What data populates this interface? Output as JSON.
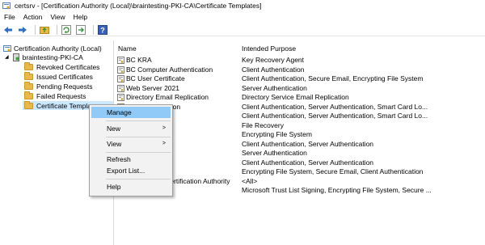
{
  "window": {
    "title": "certsrv - [Certification Authority (Local)\\braintesting-PKI-CA\\Certificate Templates]"
  },
  "menu": {
    "items": [
      "File",
      "Action",
      "View",
      "Help"
    ]
  },
  "toolbar": {
    "icons": [
      "back-icon",
      "forward-icon",
      "up-folder-icon",
      "refresh-icon",
      "export-icon",
      "help-icon"
    ]
  },
  "tree": {
    "root": "Certification Authority (Local)",
    "ca": "braintesting-PKI-CA",
    "items": [
      "Revoked Certificates",
      "Issued Certificates",
      "Pending Requests",
      "Failed Requests",
      "Certificate Templa"
    ]
  },
  "list": {
    "columns": {
      "name": "Name",
      "purpose": "Intended Purpose"
    },
    "rows": [
      {
        "name": "BC KRA",
        "purpose": "Key Recovery Agent"
      },
      {
        "name": "BC Computer Authentication",
        "purpose": "Client Authentication"
      },
      {
        "name": "BC User Certificate",
        "purpose": "Client Authentication, Secure Email, Encrypting File System"
      },
      {
        "name": "Web Server 2021",
        "purpose": "Server Authentication"
      },
      {
        "name": "Directory Email Replication",
        "purpose": "Directory Service Email Replication"
      },
      {
        "name": "ller Authentication",
        "purpose": "Client Authentication, Server Authentication, Smart Card Lo..."
      },
      {
        "name": "ntication",
        "purpose": "Client Authentication, Server Authentication, Smart Card Lo..."
      },
      {
        "name": "gent",
        "purpose": "File Recovery"
      },
      {
        "name": "",
        "purpose": "Encrypting File System"
      },
      {
        "name": "ller",
        "purpose": "Client Authentication, Server Authentication"
      },
      {
        "name": "",
        "purpose": "Server Authentication"
      },
      {
        "name": "",
        "purpose": "Client Authentication, Server Authentication"
      },
      {
        "name": "",
        "purpose": "Encrypting File System, Secure Email, Client Authentication"
      },
      {
        "name": "Subordinate Certification Authority",
        "purpose": "<All>"
      },
      {
        "name": "Administrator",
        "purpose": "Microsoft Trust List Signing, Encrypting File System, Secure ..."
      }
    ]
  },
  "context_menu": {
    "manage": "Manage",
    "new": "New",
    "view": "View",
    "refresh": "Refresh",
    "export": "Export List...",
    "help": "Help",
    "submenu_arrow": ">"
  },
  "colors": {
    "selection": "#cce8ff",
    "menu_highlight": "#91c9f7",
    "folder": "#e8b84a"
  }
}
